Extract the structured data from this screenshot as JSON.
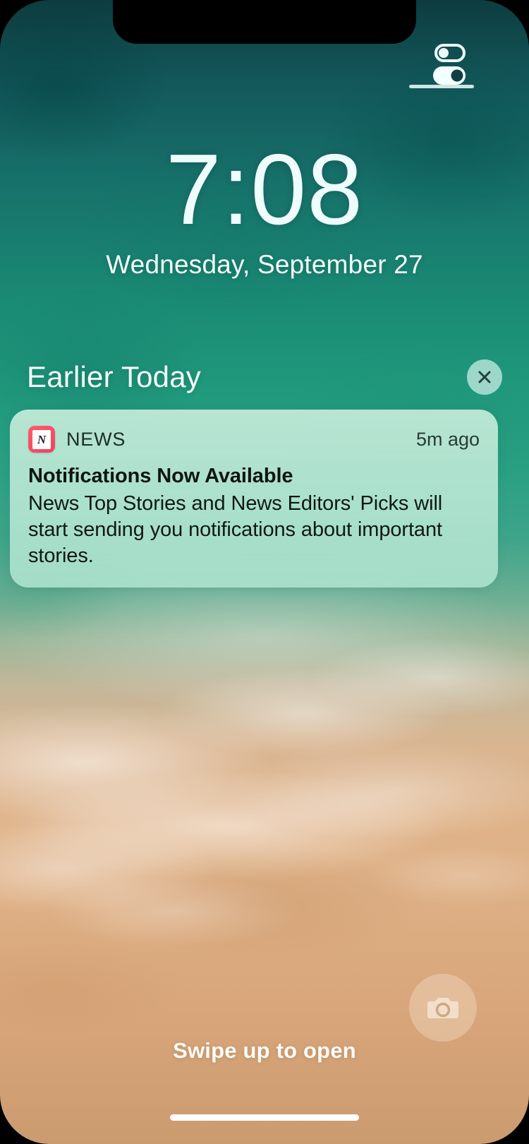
{
  "device": {
    "notch": "notch",
    "home_indicator": "home-indicator"
  },
  "status_bar": {
    "accessibility_icon": "toggles-icon",
    "icon_label": "accessibility-toggles"
  },
  "clock": {
    "time": "7:08",
    "date": "Wednesday, September 27"
  },
  "notifications_section": {
    "title": "Earlier Today",
    "clear_icon": "close-icon",
    "clear_label": "×"
  },
  "notification": {
    "app_icon": "news-app-icon",
    "app_icon_glyph": "N",
    "app_name": "NEWS",
    "timestamp": "5m ago",
    "title": "Notifications Now Available",
    "body": "News Top Stories and News Editors' Picks will start sending you notifications about important stories."
  },
  "bottom": {
    "camera_icon": "camera-icon",
    "swipe_hint": "Swipe up to open"
  },
  "colors": {
    "accent_news": "#f0425d",
    "notification_bg": "#bfe9d4",
    "text_light": "#ffffff",
    "water_teal": "#1a8a74",
    "sand": "#dbb189"
  }
}
